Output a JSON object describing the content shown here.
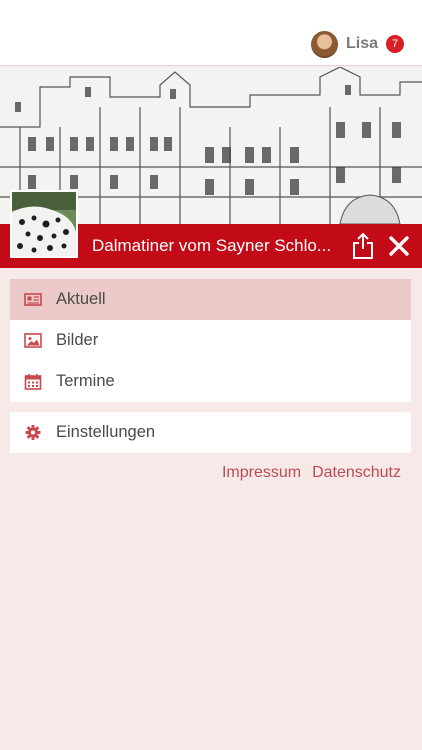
{
  "user": {
    "name": "Lisa",
    "notification_count": "7"
  },
  "hero": {
    "title": "Dalmatiner vom Sayner Schlo..."
  },
  "menu_primary": [
    {
      "label": "Aktuell",
      "icon": "newspaper-icon",
      "active": true
    },
    {
      "label": "Bilder",
      "icon": "image-icon",
      "active": false
    },
    {
      "label": "Termine",
      "icon": "calendar-icon",
      "active": false
    }
  ],
  "menu_secondary": [
    {
      "label": "Einstellungen",
      "icon": "gear-icon",
      "active": false
    }
  ],
  "footer": {
    "impressum": "Impressum",
    "datenschutz": "Datenschutz"
  },
  "colors": {
    "brand_red": "#c30b17",
    "background": "#f8e9e9",
    "active_item": "#eccaca",
    "link": "#b84c54",
    "icon": "#c8494f"
  }
}
